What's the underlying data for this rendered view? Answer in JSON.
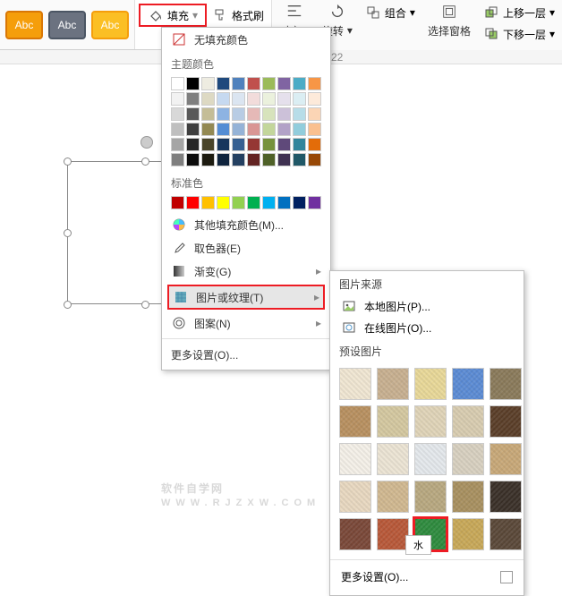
{
  "toolbar": {
    "style_label": "Abc",
    "fill": "填充",
    "format_painter": "格式刷",
    "align": "对齐",
    "rotate": "旋转",
    "group": "组合",
    "select_pane": "选择窗格",
    "move_up": "上移一层",
    "move_down": "下移一层"
  },
  "ruler": {
    "mark22": "22"
  },
  "menu": {
    "no_fill": "无填充颜色",
    "theme_colors": "主题颜色",
    "standard_colors": "标准色",
    "more_colors": "其他填充颜色(M)...",
    "eyedropper": "取色器(E)",
    "gradient": "渐变(G)",
    "picture_texture": "图片或纹理(T)",
    "pattern": "图案(N)",
    "more_settings": "更多设置(O)..."
  },
  "submenu": {
    "source": "图片来源",
    "local": "本地图片(P)...",
    "online": "在线图片(O)...",
    "preset": "预设图片",
    "more_settings": "更多设置(O)..."
  },
  "tooltip": "水",
  "watermark": {
    "main": "软件自学网",
    "sub": "WWW.RJZXW.COM"
  },
  "theme_colors": [
    [
      "#ffffff",
      "#000000",
      "#eeece1",
      "#1f497d",
      "#4f81bd",
      "#c0504d",
      "#9bbb59",
      "#8064a2",
      "#4bacc6",
      "#f79646"
    ],
    [
      "#f2f2f2",
      "#7f7f7f",
      "#ddd9c3",
      "#c6d9f0",
      "#dbe5f1",
      "#f2dcdb",
      "#ebf1dd",
      "#e5e0ec",
      "#dbeef3",
      "#fdeada"
    ],
    [
      "#d8d8d8",
      "#595959",
      "#c4bd97",
      "#8db3e2",
      "#b8cce4",
      "#e5b9b7",
      "#d7e3bc",
      "#ccc1d9",
      "#b7dde8",
      "#fbd5b5"
    ],
    [
      "#bfbfbf",
      "#3f3f3f",
      "#938953",
      "#548dd4",
      "#95b3d7",
      "#d99694",
      "#c3d69b",
      "#b2a2c7",
      "#92cddc",
      "#fac08f"
    ],
    [
      "#a5a5a5",
      "#262626",
      "#494429",
      "#17365d",
      "#366092",
      "#953734",
      "#76923c",
      "#5f497a",
      "#31859b",
      "#e36c09"
    ],
    [
      "#7f7f7f",
      "#0c0c0c",
      "#1d1b10",
      "#0f243e",
      "#244061",
      "#632423",
      "#4f6128",
      "#3f3151",
      "#205867",
      "#974806"
    ]
  ],
  "standard_colors": [
    "#c00000",
    "#ff0000",
    "#ffc000",
    "#ffff00",
    "#92d050",
    "#00b050",
    "#00b0f0",
    "#0070c0",
    "#002060",
    "#7030a0"
  ],
  "textures": [
    "#f0e6d2",
    "#c8b090",
    "#e8d898",
    "#5b8bd4",
    "#8a7a5a",
    "#b89060",
    "#d4c8a0",
    "#e0d4b8",
    "#d8ccb0",
    "#5a3e28",
    "#f4f0e8",
    "#ece4d4",
    "#e4e8ec",
    "#d8d0c0",
    "#c8a878",
    "#e8d8c0",
    "#d0b890",
    "#b8a880",
    "#a89060",
    "#3a3028",
    "#7a4838",
    "#b85838",
    "#2e8b3e",
    "#c8a858",
    "#5a4838"
  ],
  "selected_texture_index": 22
}
